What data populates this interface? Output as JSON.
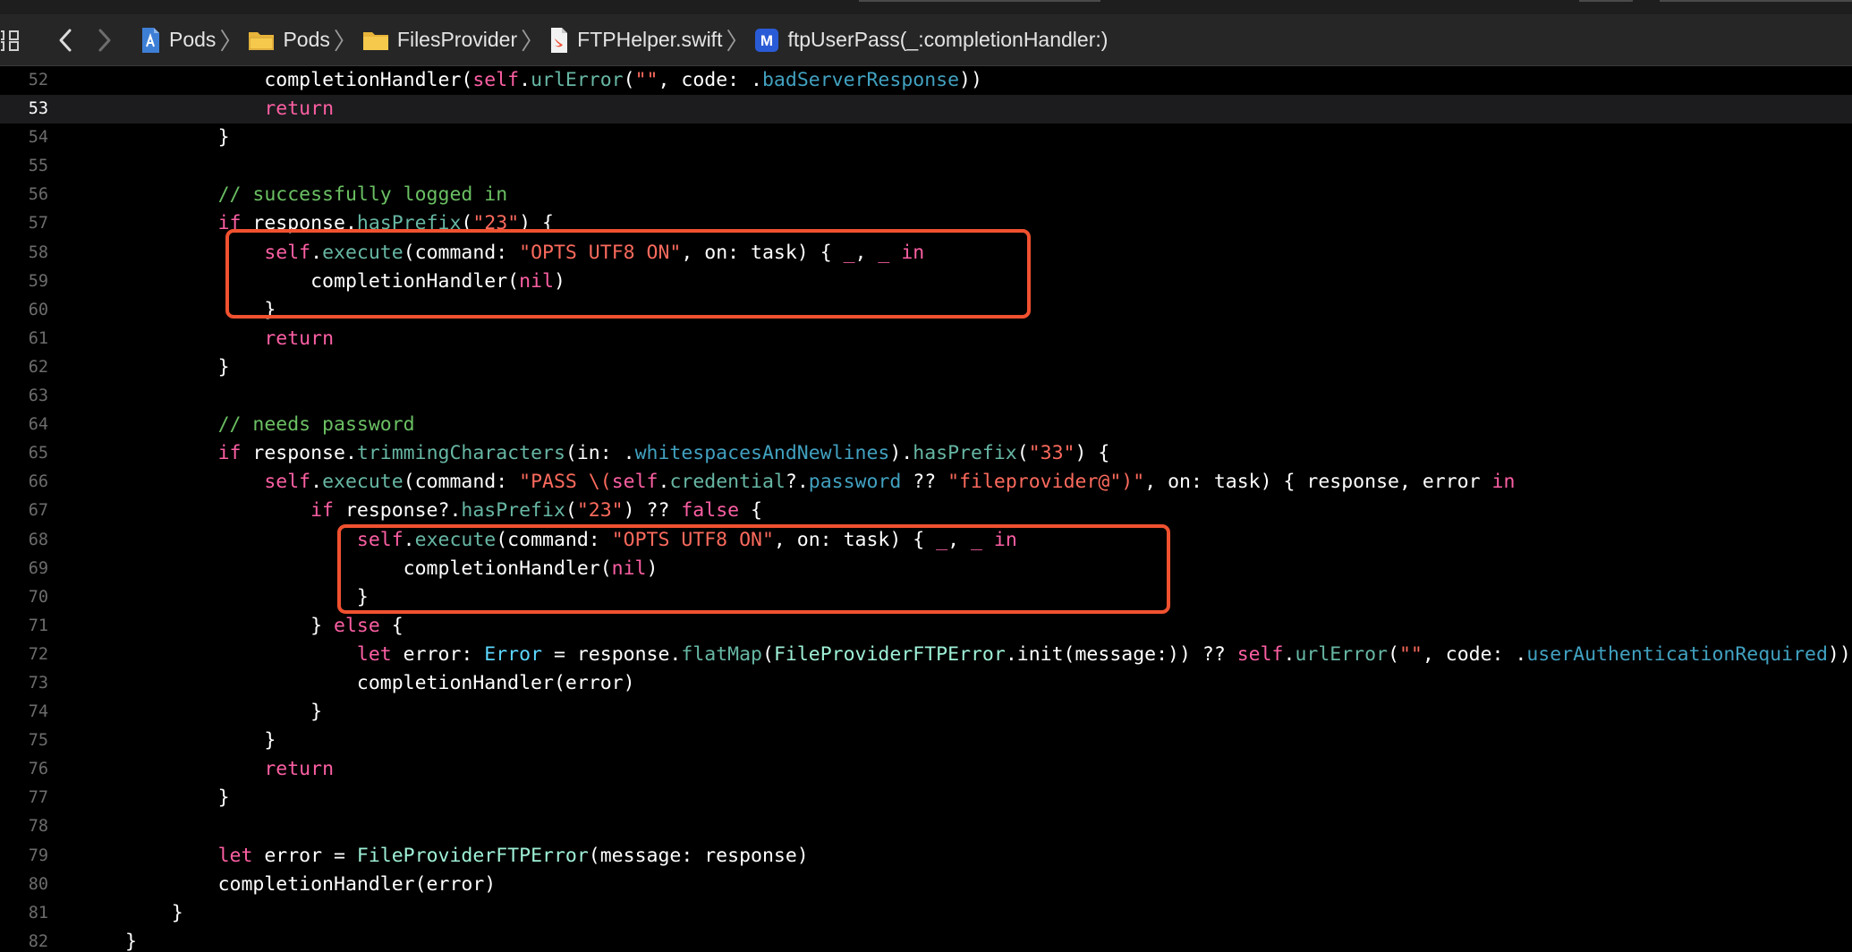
{
  "breadcrumbs": [
    {
      "label": "Pods",
      "icon": "project-icon"
    },
    {
      "label": "Pods",
      "icon": "group-folder-icon"
    },
    {
      "label": "FilesProvider",
      "icon": "folder-icon"
    },
    {
      "label": "FTPHelper.swift",
      "icon": "swift-file-icon"
    },
    {
      "label": "ftpUserPass(_:completionHandler:)",
      "icon": "method-icon"
    }
  ],
  "icons": {
    "grid": "grid-icon",
    "back": "chevron-left-icon",
    "forward": "chevron-right-icon",
    "method_badge": "M"
  },
  "colors": {
    "background": "#000000",
    "keyword": "#fc5fa3",
    "string": "#fc6a5d",
    "comment": "#6bc063",
    "highlight_box": "#f0512f"
  },
  "editor": {
    "current_line": 53,
    "lines": [
      {
        "n": "52",
        "indent": 12,
        "tokens": [
          [
            "",
            "completionHandler("
          ],
          [
            "self",
            "self"
          ],
          [
            "",
            "."
          ],
          [
            "fn",
            "urlError"
          ],
          [
            "",
            "("
          ],
          [
            "str",
            "\"\""
          ],
          [
            "",
            ", code: ."
          ],
          [
            "mem",
            "badServerResponse"
          ],
          [
            "",
            "))"
          ]
        ]
      },
      {
        "n": "53",
        "indent": 12,
        "tokens": [
          [
            "kw",
            "return"
          ]
        ]
      },
      {
        "n": "54",
        "indent": 8,
        "tokens": [
          [
            "",
            "}"
          ]
        ]
      },
      {
        "n": "55",
        "indent": 0,
        "tokens": []
      },
      {
        "n": "56",
        "indent": 8,
        "tokens": [
          [
            "cm",
            "// successfully logged in"
          ]
        ]
      },
      {
        "n": "57",
        "indent": 8,
        "tokens": [
          [
            "kw",
            "if"
          ],
          [
            "",
            " response."
          ],
          [
            "fn",
            "hasPrefix"
          ],
          [
            "",
            "("
          ],
          [
            "str",
            "\"23\""
          ],
          [
            "",
            ") {"
          ]
        ]
      },
      {
        "n": "58",
        "indent": 12,
        "tokens": [
          [
            "self",
            "self"
          ],
          [
            "",
            "."
          ],
          [
            "fn",
            "execute"
          ],
          [
            "",
            "(command: "
          ],
          [
            "str",
            "\"OPTS UTF8 ON\""
          ],
          [
            "",
            ", on: task) { "
          ],
          [
            "kw",
            "_"
          ],
          [
            "",
            ", "
          ],
          [
            "kw",
            "_"
          ],
          [
            "",
            " "
          ],
          [
            "kw",
            "in"
          ]
        ]
      },
      {
        "n": "59",
        "indent": 16,
        "tokens": [
          [
            "",
            "completionHandler("
          ],
          [
            "kw",
            "nil"
          ],
          [
            "",
            ")"
          ]
        ]
      },
      {
        "n": "60",
        "indent": 12,
        "tokens": [
          [
            "",
            "}"
          ]
        ]
      },
      {
        "n": "61",
        "indent": 12,
        "tokens": [
          [
            "kw",
            "return"
          ]
        ]
      },
      {
        "n": "62",
        "indent": 8,
        "tokens": [
          [
            "",
            "}"
          ]
        ]
      },
      {
        "n": "63",
        "indent": 0,
        "tokens": []
      },
      {
        "n": "64",
        "indent": 8,
        "tokens": [
          [
            "cm",
            "// needs password"
          ]
        ]
      },
      {
        "n": "65",
        "indent": 8,
        "tokens": [
          [
            "kw",
            "if"
          ],
          [
            "",
            " response."
          ],
          [
            "fn",
            "trimmingCharacters"
          ],
          [
            "",
            "(in: ."
          ],
          [
            "mem",
            "whitespacesAndNewlines"
          ],
          [
            "",
            ")."
          ],
          [
            "fn",
            "hasPrefix"
          ],
          [
            "",
            "("
          ],
          [
            "str",
            "\"33\""
          ],
          [
            "",
            ") {"
          ]
        ]
      },
      {
        "n": "66",
        "indent": 12,
        "tokens": [
          [
            "self",
            "self"
          ],
          [
            "",
            "."
          ],
          [
            "fn",
            "execute"
          ],
          [
            "",
            "(command: "
          ],
          [
            "str",
            "\"PASS \\("
          ],
          [
            "self",
            "self"
          ],
          [
            "",
            "."
          ],
          [
            "fn",
            "credential"
          ],
          [
            "",
            "?."
          ],
          [
            "mem",
            "password"
          ],
          [
            "",
            " ?? "
          ],
          [
            "str",
            "\"fileprovider@\""
          ],
          [
            "str",
            ")\""
          ],
          [
            "",
            ", on: task) { response, error "
          ],
          [
            "kw",
            "in"
          ]
        ]
      },
      {
        "n": "67",
        "indent": 16,
        "tokens": [
          [
            "kw",
            "if"
          ],
          [
            "",
            " response?."
          ],
          [
            "fn",
            "hasPrefix"
          ],
          [
            "",
            "("
          ],
          [
            "str",
            "\"23\""
          ],
          [
            "",
            ") ?? "
          ],
          [
            "kw",
            "false"
          ],
          [
            "",
            " {"
          ]
        ]
      },
      {
        "n": "68",
        "indent": 20,
        "tokens": [
          [
            "self",
            "self"
          ],
          [
            "",
            "."
          ],
          [
            "fn",
            "execute"
          ],
          [
            "",
            "(command: "
          ],
          [
            "str",
            "\"OPTS UTF8 ON\""
          ],
          [
            "",
            ", on: task) { "
          ],
          [
            "kw",
            "_"
          ],
          [
            "",
            ", "
          ],
          [
            "kw",
            "_"
          ],
          [
            "",
            " "
          ],
          [
            "kw",
            "in"
          ]
        ]
      },
      {
        "n": "69",
        "indent": 24,
        "tokens": [
          [
            "",
            "completionHandler("
          ],
          [
            "kw",
            "nil"
          ],
          [
            "",
            ")"
          ]
        ]
      },
      {
        "n": "70",
        "indent": 20,
        "tokens": [
          [
            "",
            "}"
          ]
        ]
      },
      {
        "n": "71",
        "indent": 16,
        "tokens": [
          [
            "",
            "} "
          ],
          [
            "kw",
            "else"
          ],
          [
            "",
            " {"
          ]
        ]
      },
      {
        "n": "72",
        "indent": 20,
        "tokens": [
          [
            "kw",
            "let"
          ],
          [
            "",
            " error: "
          ],
          [
            "ty",
            "Error"
          ],
          [
            "",
            " = response."
          ],
          [
            "fn",
            "flatMap"
          ],
          [
            "",
            "("
          ],
          [
            "typ2",
            "FileProviderFTPError"
          ],
          [
            "",
            ".init(message:)) ?? "
          ],
          [
            "self",
            "self"
          ],
          [
            "",
            "."
          ],
          [
            "fn",
            "urlError"
          ],
          [
            "",
            "("
          ],
          [
            "str",
            "\"\""
          ],
          [
            "",
            ", code: ."
          ],
          [
            "mem",
            "userAuthenticationRequired"
          ],
          [
            "",
            "))"
          ]
        ]
      },
      {
        "n": "73",
        "indent": 20,
        "tokens": [
          [
            "",
            "completionHandler(error)"
          ]
        ]
      },
      {
        "n": "74",
        "indent": 16,
        "tokens": [
          [
            "",
            "}"
          ]
        ]
      },
      {
        "n": "75",
        "indent": 12,
        "tokens": [
          [
            "",
            "}"
          ]
        ]
      },
      {
        "n": "76",
        "indent": 12,
        "tokens": [
          [
            "kw",
            "return"
          ]
        ]
      },
      {
        "n": "77",
        "indent": 8,
        "tokens": [
          [
            "",
            "}"
          ]
        ]
      },
      {
        "n": "78",
        "indent": 0,
        "tokens": []
      },
      {
        "n": "79",
        "indent": 8,
        "tokens": [
          [
            "kw",
            "let"
          ],
          [
            "",
            " error = "
          ],
          [
            "typ2",
            "FileProviderFTPError"
          ],
          [
            "",
            "(message: response)"
          ]
        ]
      },
      {
        "n": "80",
        "indent": 8,
        "tokens": [
          [
            "",
            "completionHandler(error)"
          ]
        ]
      },
      {
        "n": "81",
        "indent": 4,
        "tokens": [
          [
            "",
            "}"
          ]
        ]
      },
      {
        "n": "82",
        "indent": 0,
        "tokens": [
          [
            "",
            "}"
          ]
        ]
      }
    ]
  }
}
